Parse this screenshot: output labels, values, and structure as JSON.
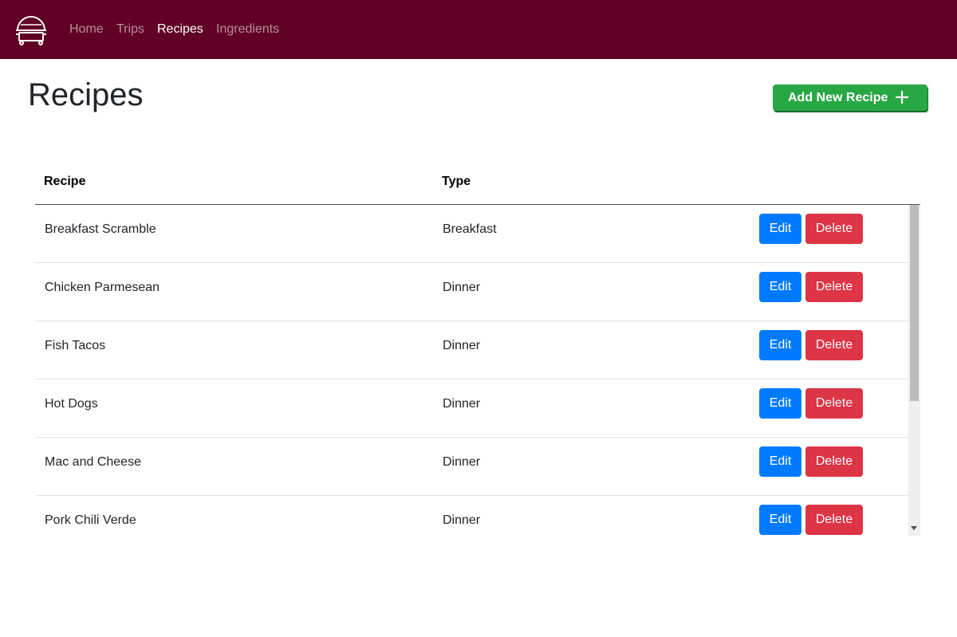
{
  "nav": {
    "logo_icon": "cooking-pot-icon",
    "links": [
      "Home",
      "Trips",
      "Recipes",
      "Ingredients"
    ],
    "active": "Recipes"
  },
  "page": {
    "title": "Recipes",
    "add_button_label": "Add New Recipe",
    "add_button_icon": "plus-icon"
  },
  "table": {
    "columns": [
      "Recipe",
      "Type"
    ],
    "rows": [
      {
        "recipe": "Breakfast Scramble",
        "type": "Breakfast"
      },
      {
        "recipe": "Chicken Parmesean",
        "type": "Dinner"
      },
      {
        "recipe": "Fish Tacos",
        "type": "Dinner"
      },
      {
        "recipe": "Hot Dogs",
        "type": "Dinner"
      },
      {
        "recipe": "Mac and Cheese",
        "type": "Dinner"
      },
      {
        "recipe": "Pork Chili Verde",
        "type": "Dinner"
      }
    ],
    "edit_label": "Edit",
    "delete_label": "Delete"
  },
  "colors": {
    "navbar": "#600024",
    "add_button": "#28a745",
    "edit_button": "#007bff",
    "delete_button": "#dc3545"
  }
}
